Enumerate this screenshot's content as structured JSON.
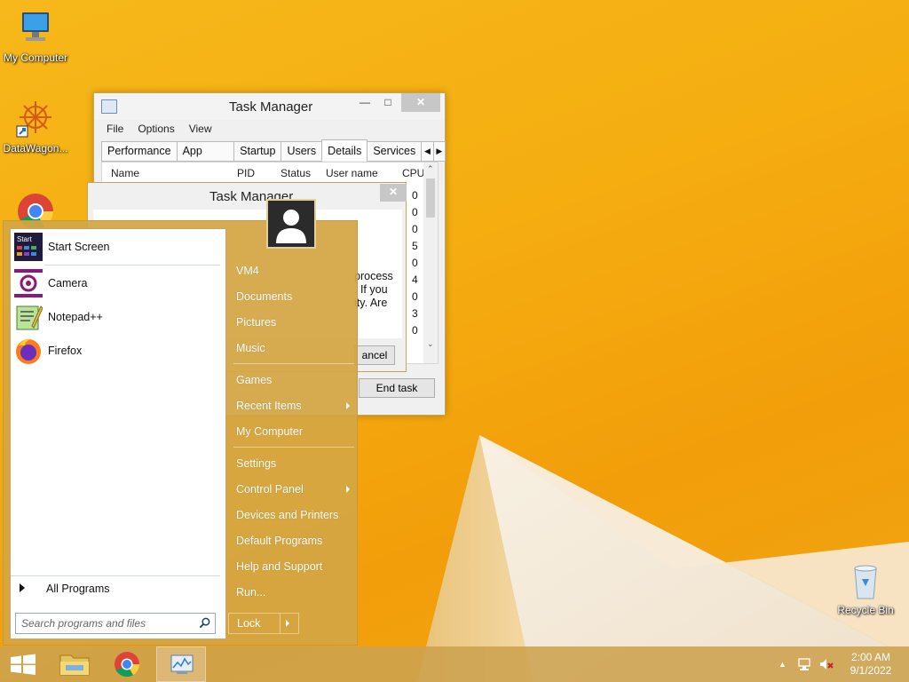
{
  "desktop": {
    "icons": [
      {
        "label": "My Computer"
      },
      {
        "label": "DataWagon..."
      },
      {
        "label": "Recycle Bin"
      }
    ]
  },
  "task_manager": {
    "title": "Task Manager",
    "menu": [
      "File",
      "Options",
      "View"
    ],
    "tabs": [
      "Performance",
      "App history",
      "Startup",
      "Users",
      "Details",
      "Services"
    ],
    "active_tab": "Details",
    "columns": [
      "Name",
      "PID",
      "Status",
      "User name",
      "CPU"
    ],
    "cpu_values": [
      "0",
      "0",
      "0",
      "5",
      "0",
      "4",
      "0",
      "3",
      "0"
    ],
    "end_task_label": "End task"
  },
  "dialog": {
    "title": "Task Manager",
    "text_fragments": [
      "process",
      ". If you",
      "ity. Are"
    ],
    "cancel_label": "ancel"
  },
  "start_menu": {
    "pinned": [
      {
        "label": "Start Screen",
        "icon": "start-screen-icon"
      },
      {
        "label": "Camera",
        "icon": "camera-icon"
      },
      {
        "label": "Notepad++",
        "icon": "notepadpp-icon"
      },
      {
        "label": "Firefox",
        "icon": "firefox-icon"
      }
    ],
    "all_programs": "All Programs",
    "search_placeholder": "Search programs and files",
    "right_items": [
      {
        "label": "VM4"
      },
      {
        "label": "Documents"
      },
      {
        "label": "Pictures"
      },
      {
        "label": "Music"
      },
      {
        "label": "Games"
      },
      {
        "label": "Recent Items"
      },
      {
        "label": "My Computer"
      },
      {
        "label": "Settings"
      },
      {
        "label": "Control Panel"
      },
      {
        "label": "Devices and Printers"
      },
      {
        "label": "Default Programs"
      },
      {
        "label": "Help and Support"
      },
      {
        "label": "Run..."
      }
    ],
    "lock_label": "Lock"
  },
  "taskbar": {
    "clock_time": "2:00 AM",
    "clock_date": "9/1/2022"
  },
  "colors": {
    "wallpaper": "#f5ad10",
    "start_menu_bg": "#d4a644",
    "taskbar_bg": "#cca24e"
  }
}
